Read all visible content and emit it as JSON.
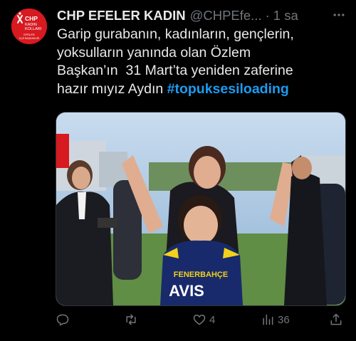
{
  "account": {
    "name": "CHP EFELER KADIN",
    "handle": "@CHPEfe...",
    "time": "1 sa",
    "avatar_text": {
      "brand": "CHP",
      "line1": "KADIN",
      "line2": "KOLLARI",
      "footer1": "EFELER",
      "footer2": "İLÇE BAŞKANLIĞI"
    }
  },
  "tweet": {
    "lines": [
      "Garip gurabanın, kadınların, gençlerin,",
      "yoksulların yanında olan Özlem",
      "Başkan’ın  31 Mart’ta yeniden zaferine"
    ],
    "last_line_prefix": "hazır mıyız Aydın ",
    "hashtag": "#topuksesiloading"
  },
  "media": {
    "jersey_text1": "FENERBAHÇE",
    "jersey_text2": "AVIS"
  },
  "actions": {
    "reply_count": "",
    "retweet_count": "",
    "like_count": "4",
    "views_count": "36"
  },
  "colors": {
    "background": "#000000",
    "text": "#e7e9ea",
    "secondary": "#71767b",
    "link": "#1d9bf0",
    "brand_red": "#d71920"
  }
}
